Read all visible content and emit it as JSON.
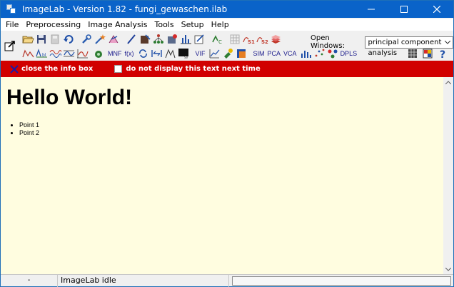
{
  "window": {
    "title": "ImageLab - Version 1.82 - fungi_gewaschen.ilab"
  },
  "menu": {
    "items": [
      "File",
      "Preprocessing",
      "Image Analysis",
      "Tools",
      "Setup",
      "Help"
    ]
  },
  "toolbar": {
    "mnf_label": "MNF",
    "fx_label": "f(x)",
    "vif_label": "VIF",
    "sim_label": "SIM",
    "pca_label": "PCA",
    "vca_label": "VCA",
    "dpls_label": "DPLS",
    "open_windows_label": "Open Windows:",
    "open_windows_value": "principal component analysis"
  },
  "infobar": {
    "close_label": "close the info box",
    "checkbox_label": "do not display this text next time",
    "background_color": "#d10000"
  },
  "content": {
    "heading": "Hello World!",
    "points": [
      "Point 1",
      "Point 2"
    ],
    "background_color": "#fffde0"
  },
  "status": {
    "cell1": "-",
    "cell2": "ImageLab idle"
  },
  "colors": {
    "titlebar": "#0a63c9"
  }
}
